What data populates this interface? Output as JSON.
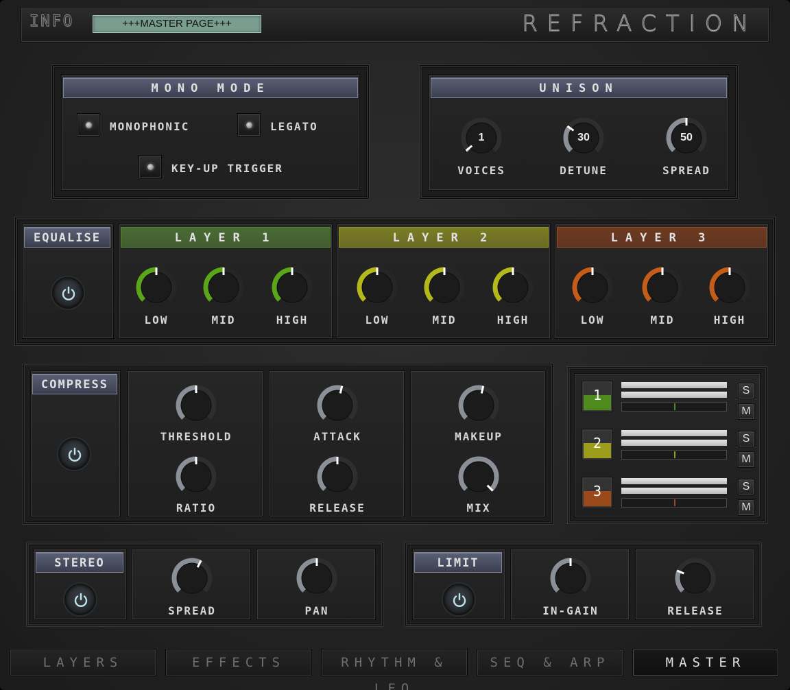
{
  "header": {
    "info_label": "INFO",
    "info_display": "+++MASTER PAGE+++",
    "logo": "REFRACTION"
  },
  "mono_mode": {
    "title": "MONO MODE",
    "monophonic": "MONOPHONIC",
    "legato": "LEGATO",
    "key_up_trigger": "KEY-UP TRIGGER"
  },
  "unison": {
    "title": "UNISON",
    "voices": {
      "label": "VOICES",
      "value": "1"
    },
    "detune": {
      "label": "DETUNE",
      "value": "30"
    },
    "spread": {
      "label": "SPREAD",
      "value": "50"
    }
  },
  "equalise": {
    "title": "EQUALISE",
    "layers": [
      {
        "title": "LAYER 1",
        "color": "#5aa51a",
        "title_bg": "#4a6b34",
        "low": "LOW",
        "mid": "MID",
        "high": "HIGH"
      },
      {
        "title": "LAYER 2",
        "color": "#b5b81a",
        "title_bg": "#7b7c25",
        "low": "LOW",
        "mid": "MID",
        "high": "HIGH"
      },
      {
        "title": "LAYER 3",
        "color": "#c45d1a",
        "title_bg": "#6e3a22",
        "low": "LOW",
        "mid": "MID",
        "high": "HIGH"
      }
    ]
  },
  "compress": {
    "title": "COMPRESS",
    "threshold": "THRESHOLD",
    "ratio": "RATIO",
    "attack": "ATTACK",
    "release": "RELEASE",
    "makeup": "MAKEUP",
    "mix": "MIX"
  },
  "mixer": {
    "channels": [
      {
        "num": "1",
        "color": "#4f8a1c",
        "solo": "S",
        "mute": "M"
      },
      {
        "num": "2",
        "color": "#9c9c1c",
        "solo": "S",
        "mute": "M"
      },
      {
        "num": "3",
        "color": "#9a4a1a",
        "solo": "S",
        "mute": "M"
      }
    ]
  },
  "stereo": {
    "title": "STEREO",
    "spread": "SPREAD",
    "pan": "PAN"
  },
  "limit": {
    "title": "LIMIT",
    "in_gain": "IN-GAIN",
    "release": "RELEASE"
  },
  "tabs": [
    {
      "label": "LAYERS",
      "active": false
    },
    {
      "label": "EFFECTS",
      "active": false
    },
    {
      "label": "RHYTHM & LFO",
      "active": false
    },
    {
      "label": "SEQ & ARP",
      "active": false
    },
    {
      "label": "MASTER",
      "active": true
    }
  ],
  "colors": {
    "panel_title": "#4a4f63",
    "info_display": "#7a9e8e",
    "accent_grey": "#8a8f98"
  }
}
